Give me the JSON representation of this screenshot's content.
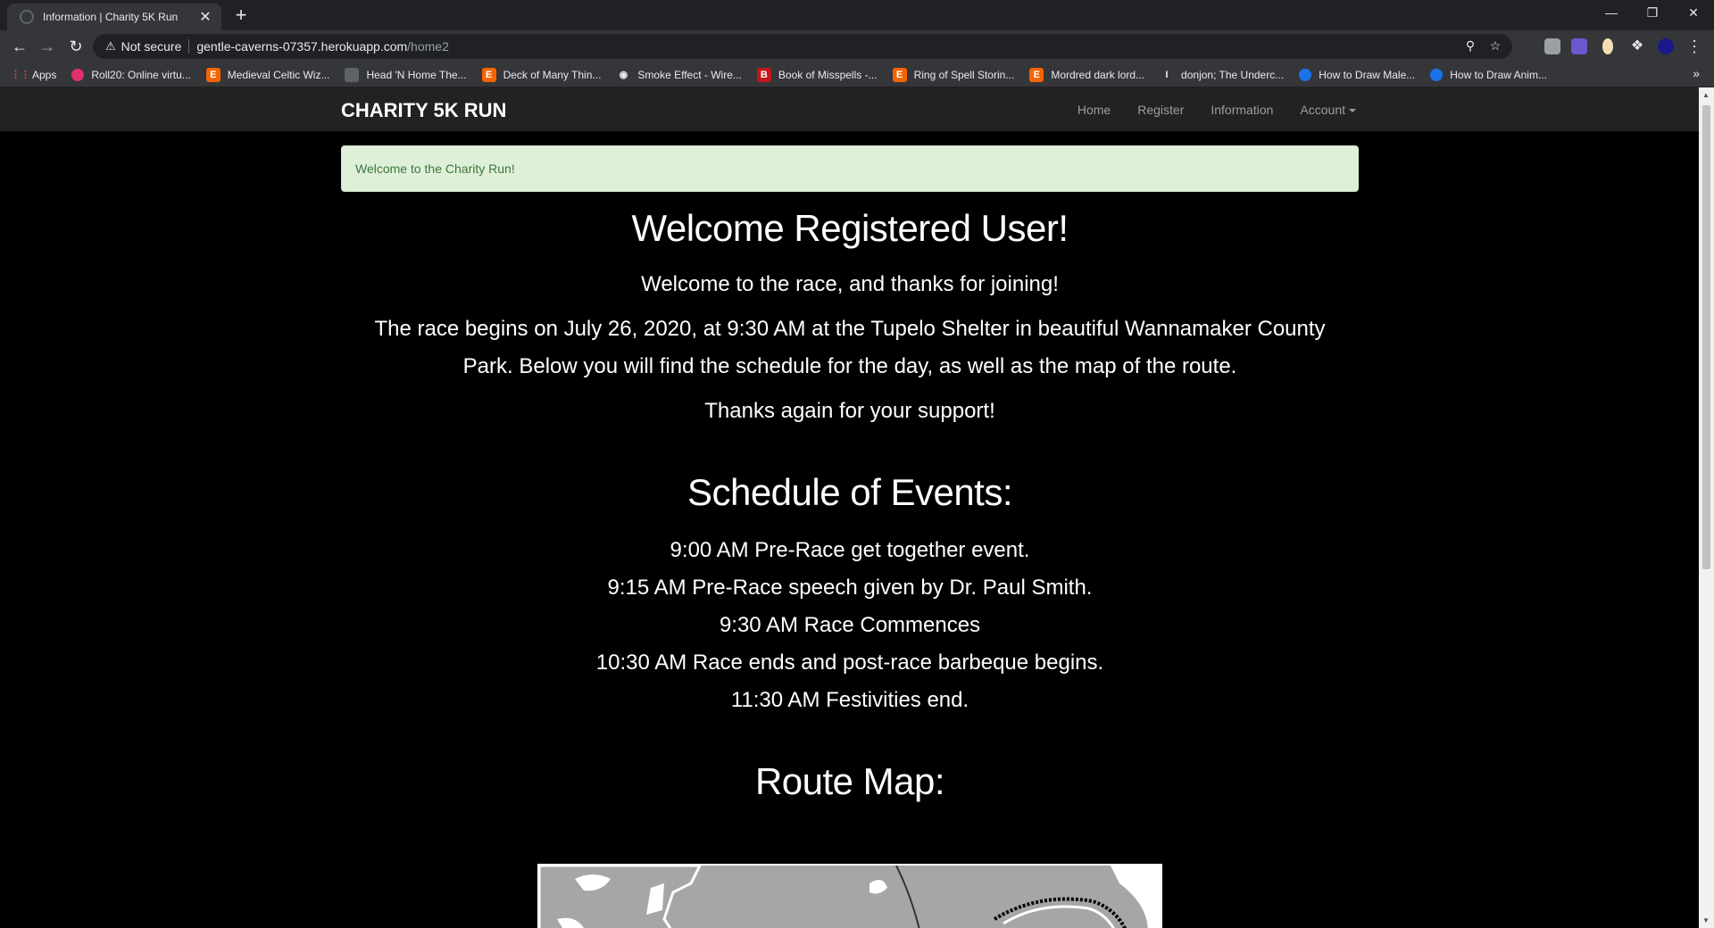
{
  "browser": {
    "tab_title": "Information | Charity 5K Run",
    "url_secure_label": "Not secure",
    "url_host": "gentle-caverns-07357.herokuapp.com",
    "url_path": "/home2",
    "bookmarks": [
      {
        "label": "Apps",
        "icon": "apps-grid-icon",
        "color": "#e8eaed"
      },
      {
        "label": "Roll20: Online virtu...",
        "icon": "roll20-icon",
        "color": "#e2306c"
      },
      {
        "label": "Medieval Celtic Wiz...",
        "icon": "etsy-icon",
        "color": "#f56400"
      },
      {
        "label": "Head 'N Home The...",
        "icon": "page-icon",
        "color": "#5f6368"
      },
      {
        "label": "Deck of Many Thin...",
        "icon": "etsy-icon",
        "color": "#f56400"
      },
      {
        "label": "Smoke Effect - Wire...",
        "icon": "globe-icon",
        "color": "#e8eaed"
      },
      {
        "label": "Book of Misspells -...",
        "icon": "b-icon",
        "color": "#c4161c"
      },
      {
        "label": "Ring of Spell Storin...",
        "icon": "etsy-icon",
        "color": "#f56400"
      },
      {
        "label": "Mordred dark lord...",
        "icon": "etsy-icon",
        "color": "#f56400"
      },
      {
        "label": "donjon; The Underc...",
        "icon": "donjon-icon",
        "color": "#e8eaed"
      },
      {
        "label": "How to Draw Male...",
        "icon": "circle-icon",
        "color": "#1a73e8"
      },
      {
        "label": "How to Draw Anim...",
        "icon": "circle-icon",
        "color": "#1a73e8"
      }
    ],
    "bookmarks_more": "»"
  },
  "site": {
    "brand": "CHARITY 5K RUN",
    "nav": {
      "home": "Home",
      "register": "Register",
      "information": "Information",
      "account": "Account"
    },
    "alert": "Welcome to the Charity Run!",
    "heading": "Welcome Registered User!",
    "intro": "Welcome to the race, and thanks for joining!",
    "details_line1": "The race begins on July 26, 2020, at 9:30 AM at the Tupelo Shelter in beautiful Wannamaker County",
    "details_line2": "Park. Below you will find the schedule for the day, as well as the map of the route.",
    "thanks": "Thanks again for your support!",
    "schedule_heading": "Schedule of Events:",
    "schedule": [
      "9:00 AM Pre-Race get together event.",
      "9:15 AM Pre-Race speech given by Dr. Paul Smith.",
      "9:30 AM Race Commences",
      "10:30 AM Race ends and post-race barbeque begins.",
      "11:30 AM Festivities end."
    ],
    "route_heading": "Route Map:"
  }
}
